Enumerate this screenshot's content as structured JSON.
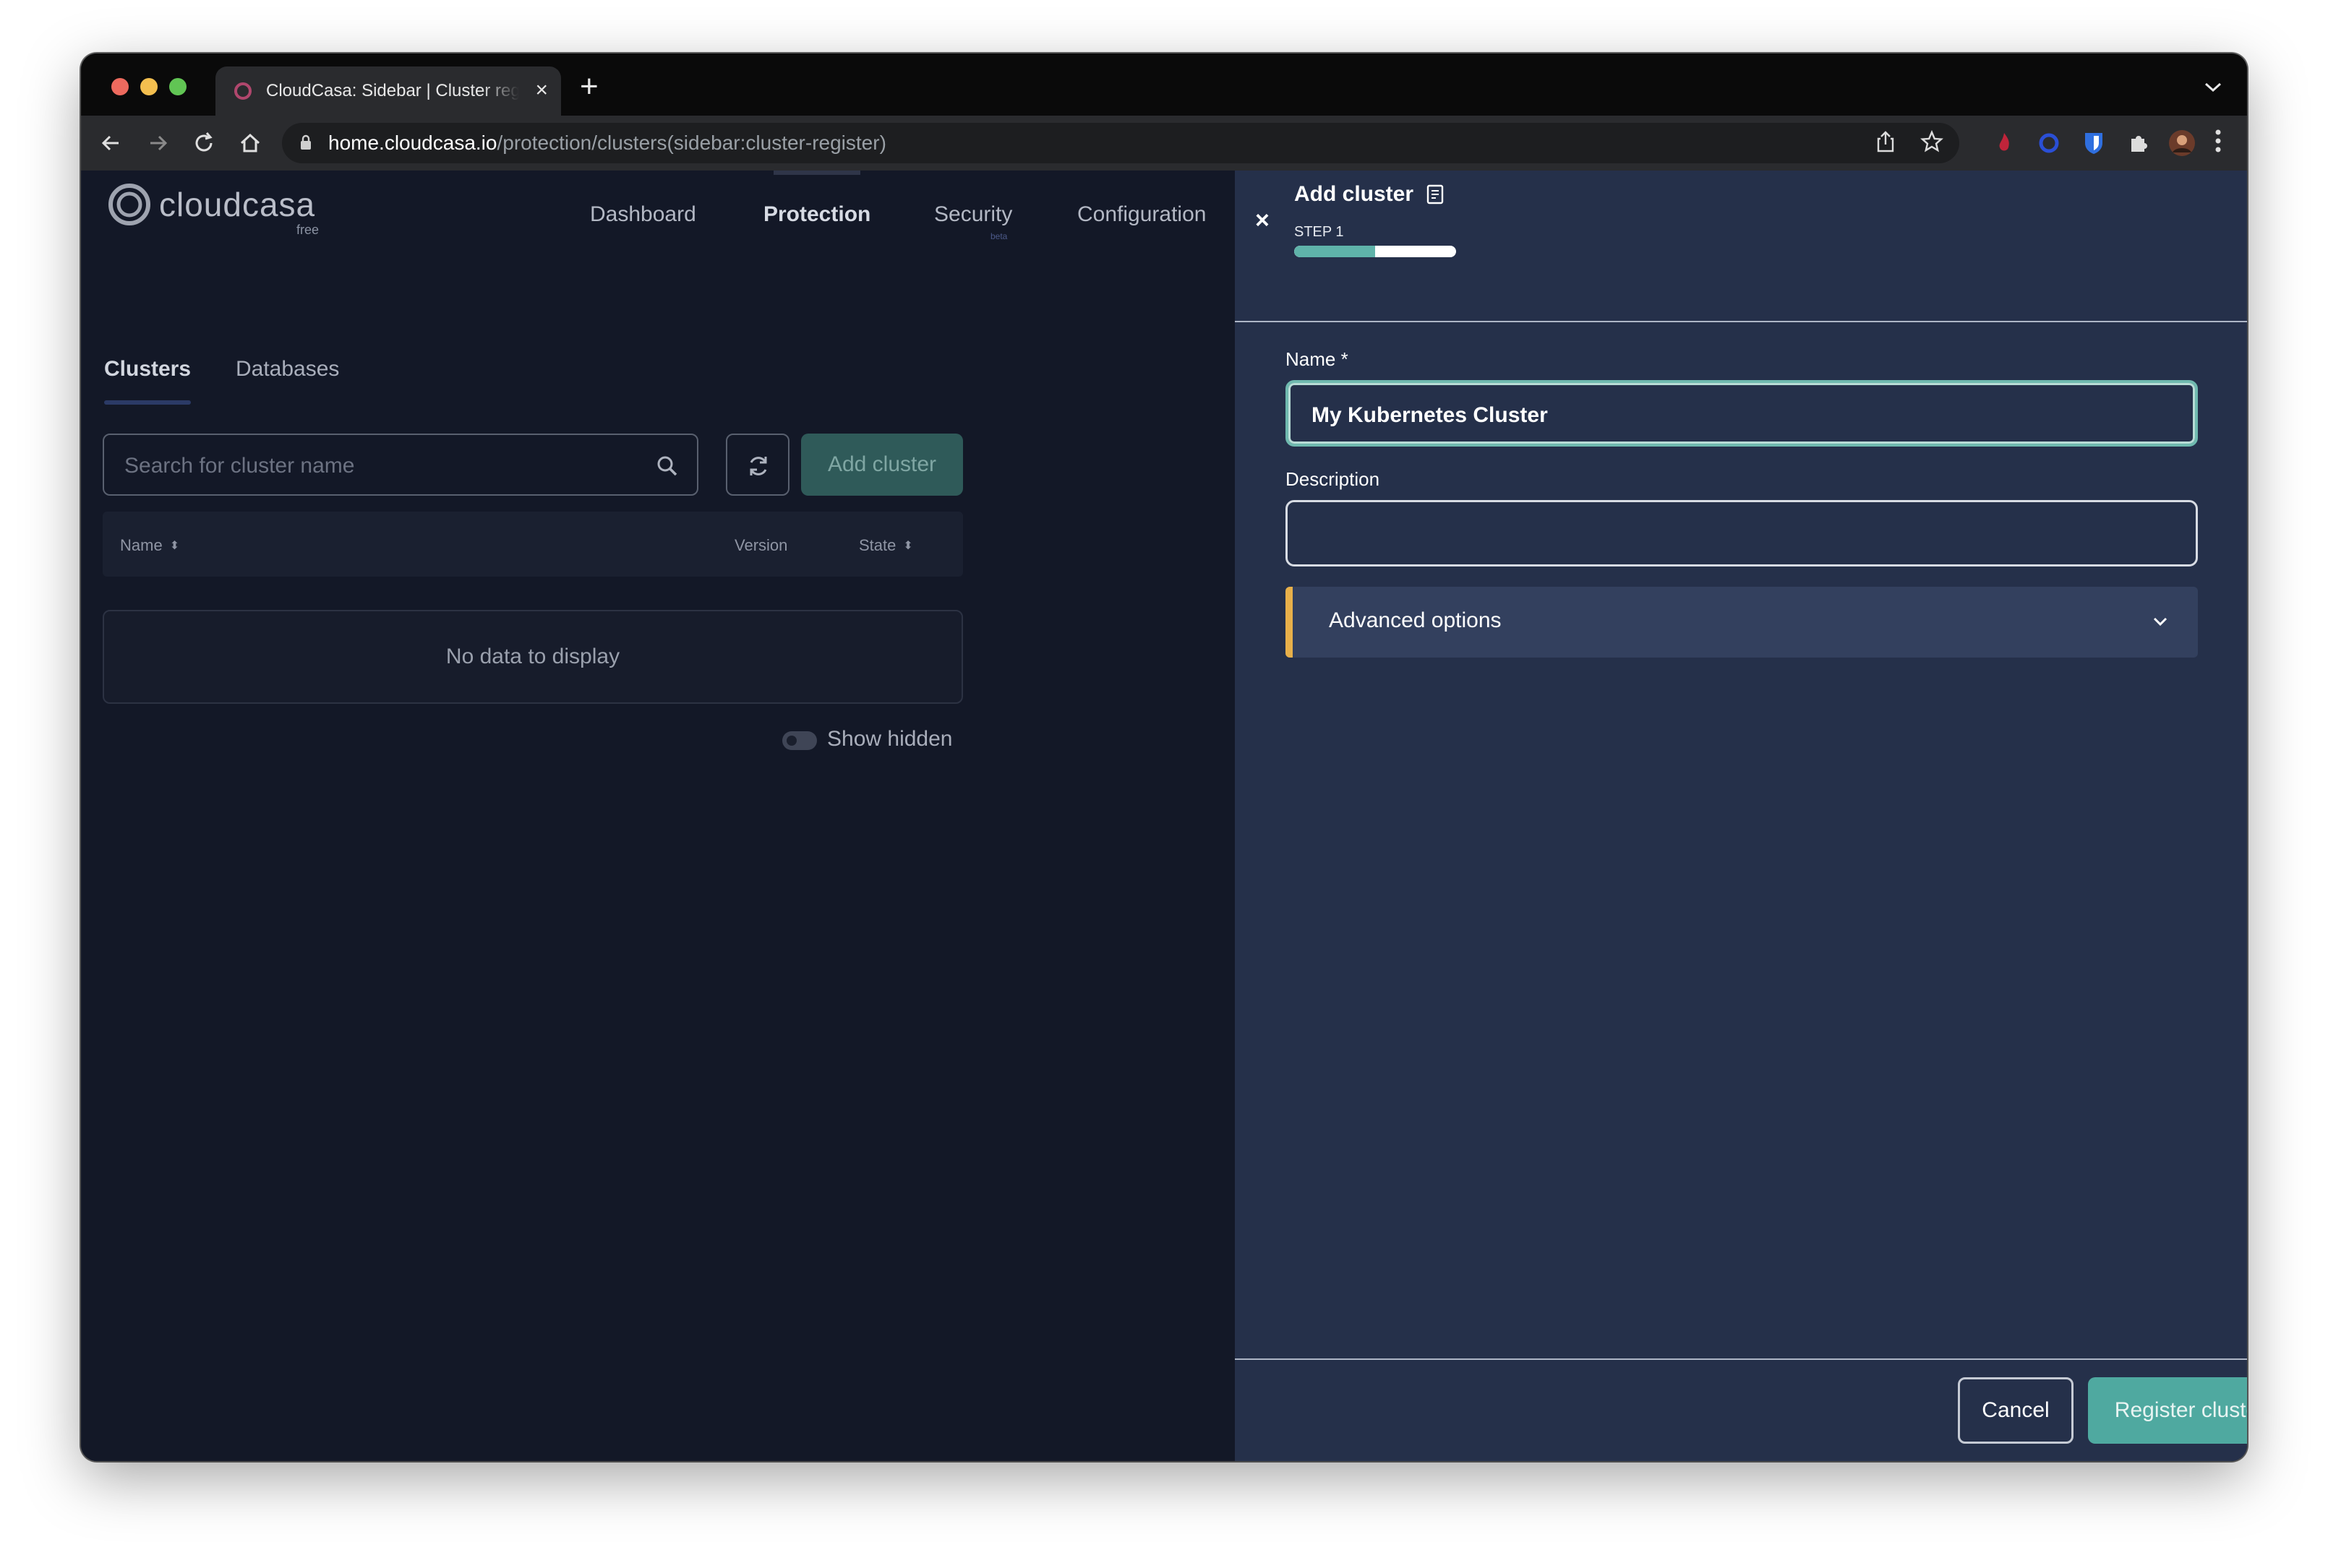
{
  "browser": {
    "tab_title": "CloudCasa: Sidebar | Cluster registration",
    "new_tab_label": "+",
    "url_host": "home.cloudcasa.io",
    "url_path": "/protection/clusters(sidebar:cluster-register)"
  },
  "app": {
    "logo_text": "cloudcasa",
    "logo_sub": "free",
    "nav": [
      "Dashboard",
      "Protection",
      "Security",
      "Configuration"
    ],
    "active_nav": "Protection",
    "security_badge": "beta"
  },
  "clusters_page": {
    "tabs": [
      "Clusters",
      "Databases"
    ],
    "active_tab": "Clusters",
    "search_placeholder": "Search for cluster name",
    "add_button": "Add cluster",
    "columns": [
      "Name",
      "Version",
      "State"
    ],
    "empty_message": "No data to display",
    "show_hidden_label": "Show hidden",
    "show_hidden_on": false
  },
  "sidebar": {
    "close_symbol": "×",
    "title": "Add cluster",
    "step_label": "STEP 1",
    "progress_fraction": 0.5,
    "name_label": "Name *",
    "name_value": "My Kubernetes Cluster",
    "description_label": "Description",
    "description_value": "",
    "advanced_label": "Advanced options",
    "cancel_button": "Cancel",
    "register_button": "Register cluster"
  },
  "colors": {
    "page_bg": "#131827",
    "sidebar_bg": "#25304a",
    "accent_teal": "#4fa9a0",
    "advanced_accent": "#e8b04a"
  },
  "icons": [
    "search-icon",
    "refresh-icon",
    "close-icon",
    "doc-icon",
    "chevron-down-icon",
    "sort-icon",
    "lock-icon",
    "share-icon",
    "star-icon",
    "extensions-icon",
    "kebab-menu-icon"
  ]
}
